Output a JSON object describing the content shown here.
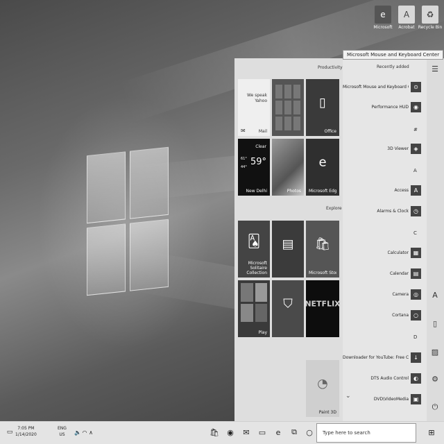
{
  "desktop": {
    "icons": [
      {
        "label": "Recycle Bin",
        "glyph": "♻"
      },
      {
        "label": "Acrobat",
        "glyph": "A"
      },
      {
        "label": "Microsoft",
        "glyph": "e"
      }
    ]
  },
  "tooltip": "Microsoft Mouse and Keyboard Center",
  "start_menu": {
    "hamburger_icon": "menu-icon",
    "recently_added_title": "Recently added",
    "groups": {
      "productivity": "Productivity",
      "explore": "Explore"
    },
    "tiles": {
      "office": "Office",
      "mail": "Mail",
      "mail_promo": "We speak Yahoo",
      "edge": "Microsoft Edge",
      "photos": "Photos",
      "weather_city": "New Delhi",
      "weather_cond": "Clear",
      "weather_temp": "59°",
      "weather_hi": "61°",
      "weather_lo": "44°",
      "store": "Microsoft Store",
      "solitaire": "Microsoft Solitaire Collection",
      "netflix": "NETFLIX",
      "play": "Play",
      "paint3d": "Paint 3D"
    },
    "app_list": [
      {
        "label": "Microsoft Mouse and Keyboard Cen...",
        "glyph": "⊙"
      },
      {
        "label": "Performance HUD",
        "glyph": "◉"
      },
      {
        "label": "3D Viewer",
        "glyph": "◈"
      },
      {
        "label": "Access",
        "glyph": "A"
      },
      {
        "label": "Alarms & Clock",
        "glyph": "◷"
      },
      {
        "label": "Calculator",
        "glyph": "▦"
      },
      {
        "label": "Calendar",
        "glyph": "▤"
      },
      {
        "label": "Camera",
        "glyph": "◎"
      },
      {
        "label": "Cortana",
        "glyph": "○"
      },
      {
        "label": "Downloader for YouTube: Free Conve...",
        "glyph": "↓"
      },
      {
        "label": "DTS Audio Control",
        "glyph": "◐"
      },
      {
        "label": "DVD\\VideoMedia",
        "glyph": "▣"
      }
    ],
    "letters": {
      "hash": "#",
      "a": "A",
      "c": "C",
      "d": "D"
    },
    "expand_glyph": "⌄",
    "side": {
      "user_glyph": "A",
      "documents_glyph": "▯",
      "pictures_glyph": "▨",
      "settings_glyph": "⚙",
      "power_glyph": "⏻"
    }
  },
  "taskbar": {
    "search_placeholder": "Type here to search",
    "time": "7:05 PM",
    "date": "1/14/2020",
    "lang_top": "ENG",
    "lang_bottom": "US",
    "icons": [
      "cortana-icon",
      "task-view-icon",
      "edge-icon",
      "explorer-icon",
      "mail-icon",
      "firefox-icon",
      "store-icon"
    ]
  }
}
